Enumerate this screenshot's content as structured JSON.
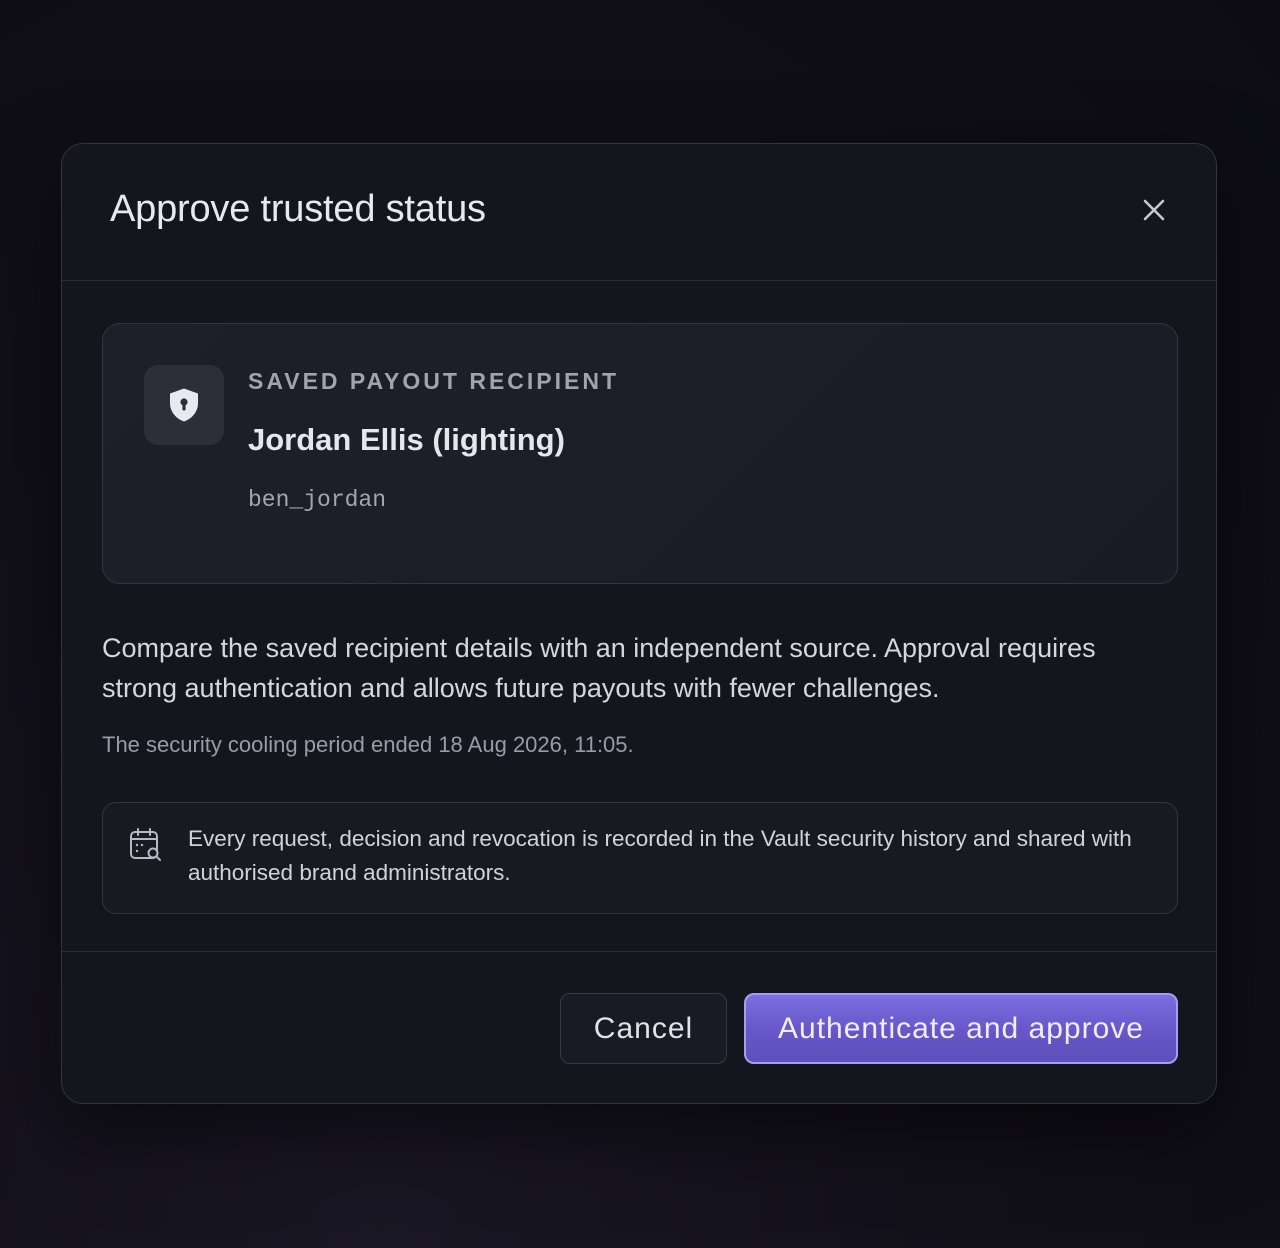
{
  "dialog": {
    "title": "Approve trusted status",
    "close_icon": "close-icon"
  },
  "recipient": {
    "icon": "shield-lock-icon",
    "kicker": "SAVED PAYOUT RECIPIENT",
    "name": "Jordan Ellis (lighting)",
    "handle": "ben_jordan"
  },
  "body": {
    "description": "Compare the saved recipient details with an independent source. Approval requires strong authentication and allows future payouts with fewer challenges.",
    "cooling_note": "The security cooling period ended 18 Aug 2026, 11:05."
  },
  "audit": {
    "icon": "calendar-search-icon",
    "text": "Every request, decision and revocation is recorded in the Vault security history and shared with authorised brand administrators."
  },
  "footer": {
    "cancel_label": "Cancel",
    "approve_label": "Authenticate and approve"
  },
  "colors": {
    "accent": "#6b5bd0",
    "accent_border": "#a99cf0",
    "surface": "#15151e",
    "background": "#0d0c13"
  }
}
